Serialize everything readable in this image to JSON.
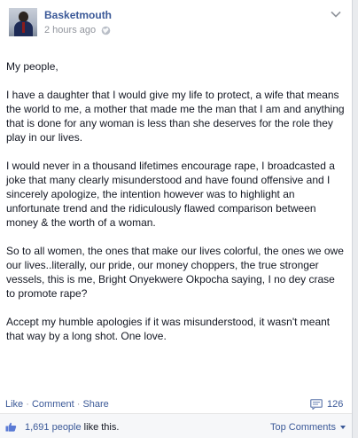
{
  "post": {
    "author": "Basketmouth",
    "timestamp": "2 hours ago",
    "privacy_icon": "globe-icon",
    "options_icon": "chevron-down-icon",
    "paragraphs": [
      "My people,",
      "I have a daughter that I would give my life to protect, a wife that means the world to me, a mother that made me the man that I am and anything that is done for any woman is less than she deserves for the role they play in our lives.",
      "I would never in a thousand lifetimes encourage rape, I broadcasted a joke that many clearly misunderstood and have found offensive and I sincerely apologize, the intention however was to highlight an unfortunate trend and the ridiculously flawed comparison between money & the worth of a woman.",
      "So to all women, the ones that make our lives colorful, the ones we owe our lives..literally, our pride, our money choppers, the true stronger vessels, this is me, Bright Onyekwere Okpocha saying, I no dey crase to promote rape?",
      "Accept my humble apologies if it was misunderstood, it wasn't meant that way by a long shot. One love."
    ]
  },
  "actions": {
    "like_label": "Like",
    "sep1": " · ",
    "comment_label": "Comment",
    "sep2": " · ",
    "share_label": "Share",
    "comment_count": "126"
  },
  "likes": {
    "count_label": "1,691 people",
    "suffix": " like this.",
    "top_comments_label": "Top Comments"
  },
  "colors": {
    "link": "#3b5998",
    "meta": "#90949c",
    "text": "#141823"
  }
}
